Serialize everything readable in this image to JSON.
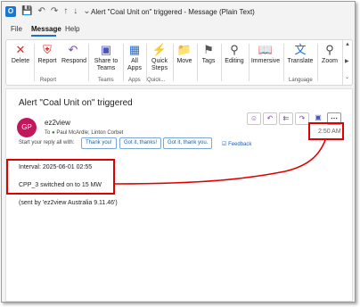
{
  "window": {
    "title": "Alert \"Coal Unit on\" triggered  -  Message (Plain Text)"
  },
  "menu": {
    "tabs": [
      {
        "label": "File"
      },
      {
        "label": "Message"
      },
      {
        "label": "Help"
      }
    ]
  },
  "ribbon": {
    "buttons": [
      {
        "label": "Delete",
        "icon": "delete-x-icon"
      },
      {
        "label": "Report",
        "icon": "shield-icon"
      },
      {
        "label": "Respond",
        "icon": "reply-icon"
      },
      {
        "label": "Share to Teams",
        "icon": "teams-icon"
      },
      {
        "label": "All Apps",
        "icon": "apps-icon"
      },
      {
        "label": "Quick Steps",
        "icon": "lightning-icon"
      },
      {
        "label": "Move",
        "icon": "folder-move-icon"
      },
      {
        "label": "Tags",
        "icon": "tag-icon"
      },
      {
        "label": "Editing",
        "icon": "magnifier-icon"
      },
      {
        "label": "Immersive",
        "icon": "immersive-reader-icon"
      },
      {
        "label": "Translate",
        "icon": "translate-icon"
      },
      {
        "label": "Zoom",
        "icon": "zoom-icon"
      }
    ],
    "groups": [
      {
        "label": "Report"
      },
      {
        "label": "Teams"
      },
      {
        "label": "Apps"
      },
      {
        "label": "Quick..."
      },
      {
        "label": "Language"
      }
    ]
  },
  "message": {
    "subject": "Alert \"Coal Unit on\" triggered",
    "sender": "ez2view",
    "avatar_initials": "GP",
    "avatar_color": "#c2185b",
    "to_label": "To",
    "recipients": "Paul McArdle;  Linton Corbet",
    "time": "2:50 AM",
    "reply_prompt": "Start your reply all with:",
    "quick_replies": [
      "Thank you!",
      "Got it, thanks!",
      "Got it, thank you."
    ],
    "feedback_label": "Feedback",
    "body": {
      "interval": "Interval: 2025-06-01 02:55",
      "event": "CPP_3 switched on to 15 MW",
      "signature": "(sent by 'ez2view Australia 9.11.46')"
    }
  },
  "colors": {
    "highlight": "#e00000",
    "accent": "#1f6fd1"
  }
}
